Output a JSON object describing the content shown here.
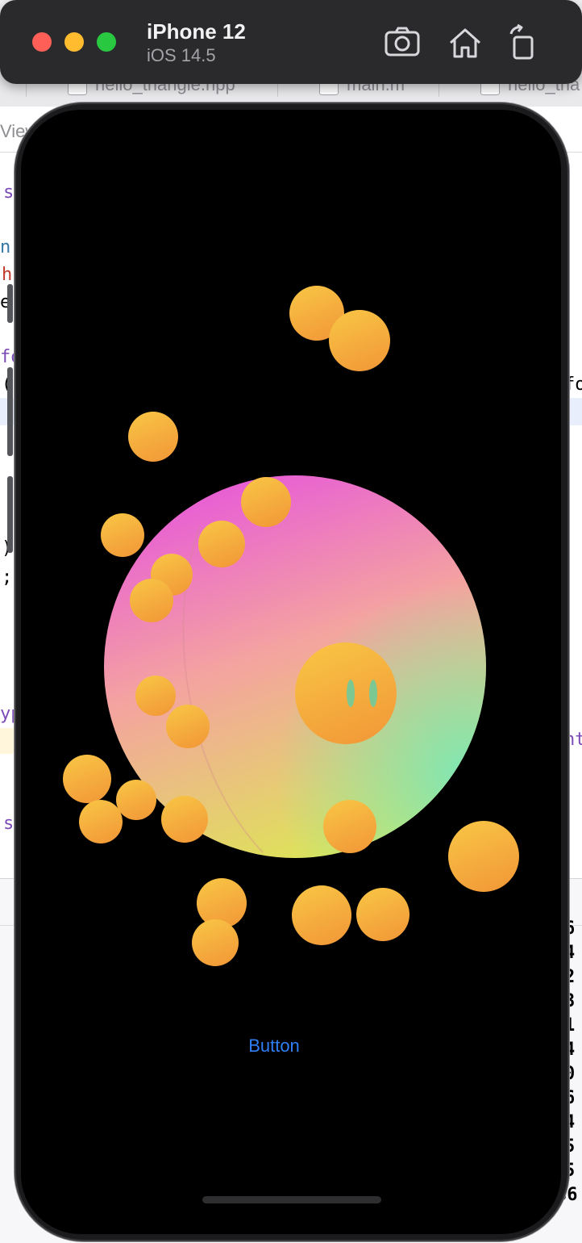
{
  "simulator": {
    "device_name": "iPhone 12",
    "os_version": "iOS 14.5",
    "toolbar": [
      {
        "name": "screenshot",
        "icon": "camera-icon"
      },
      {
        "name": "home",
        "icon": "home-icon"
      },
      {
        "name": "rotate",
        "icon": "rotate-icon"
      }
    ]
  },
  "xcode_background": {
    "tabs": [
      "hello_triangle.hpp",
      "main.m",
      "hello_tria"
    ],
    "jump_bar_fragment": "View",
    "code_fragments_left": [
      "s",
      "n",
      "h",
      "e",
      "fo",
      "(",
      ")",
      ";",
      "yp",
      "s"
    ],
    "code_fragments_right": [
      "fo",
      "nt"
    ],
    "console_fragments": [
      "6",
      "4",
      "2",
      "3",
      "1",
      "4",
      "0",
      "6",
      "4",
      "5",
      "5",
      "36"
    ]
  },
  "app": {
    "button_label": "Button",
    "colors": {
      "button_text": "#2f7ff6",
      "ball_light": "#f8c244",
      "ball_dark": "#f29a38",
      "sphere_top": "#e75ad8",
      "sphere_middle": "#f4a3a0",
      "sphere_bottom_left": "#dde655",
      "sphere_bottom_right": "#7fe6b4"
    }
  }
}
